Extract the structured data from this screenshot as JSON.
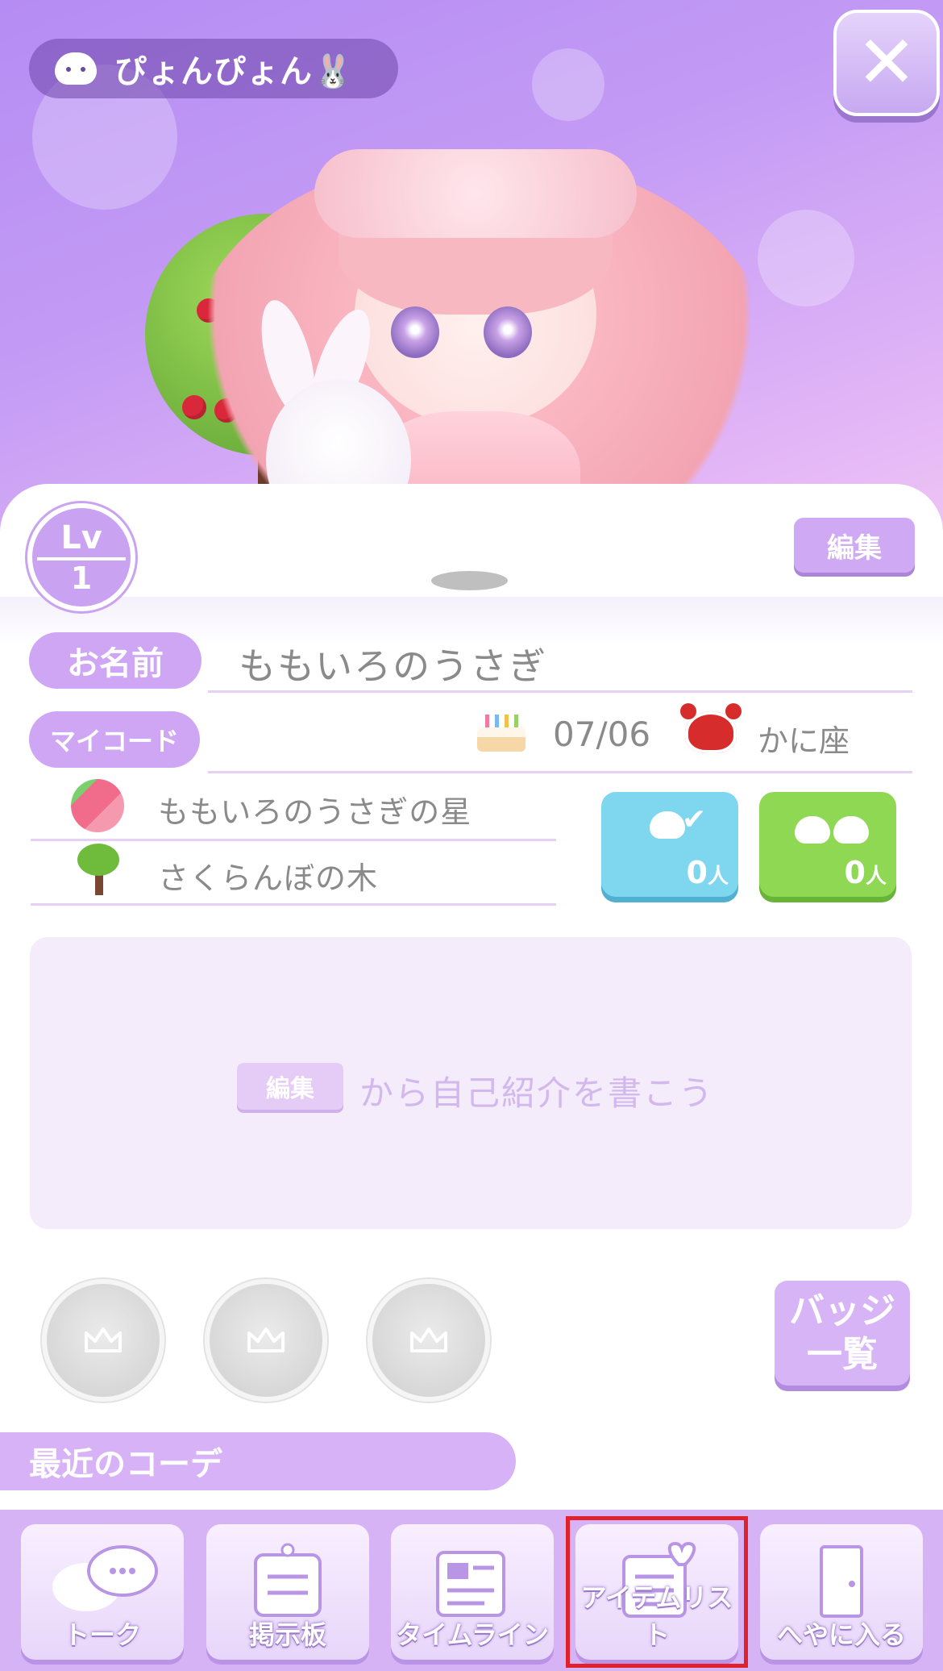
{
  "header": {
    "username": "ぴょんぴょん🐰",
    "close_symbol": "✕"
  },
  "profile": {
    "level_label": "Lv",
    "level_value": "1",
    "edit_label": "編集",
    "name_label": "お名前",
    "name_value": "ももいろのうさぎ",
    "mycode_label": "マイコード",
    "birthday": "07/06",
    "zodiac": "かに座",
    "planet": "ももいろのうさぎの星",
    "tree": "さくらんぼの木",
    "followers": {
      "count": "0",
      "unit": "人",
      "color": "#7fd6ef"
    },
    "friends": {
      "count": "0",
      "unit": "人",
      "color": "#8fd854"
    }
  },
  "intro": {
    "edit_label": "編集",
    "placeholder": "から自己紹介を書こう"
  },
  "badges": {
    "list_label_line1": "バッジ",
    "list_label_line2": "一覧"
  },
  "recent": {
    "label": "最近のコーデ"
  },
  "tabs": [
    {
      "label": "トーク",
      "icon": "chat-bubbles-icon"
    },
    {
      "label": "掲示板",
      "icon": "bulletin-board-icon"
    },
    {
      "label": "タイムライン",
      "icon": "timeline-icon"
    },
    {
      "label": "アイテムリスト",
      "icon": "item-list-icon"
    },
    {
      "label": "へやに入る",
      "icon": "door-icon"
    }
  ],
  "colors": {
    "accent": "#cfa6f4",
    "highlight": "#e0202a"
  }
}
